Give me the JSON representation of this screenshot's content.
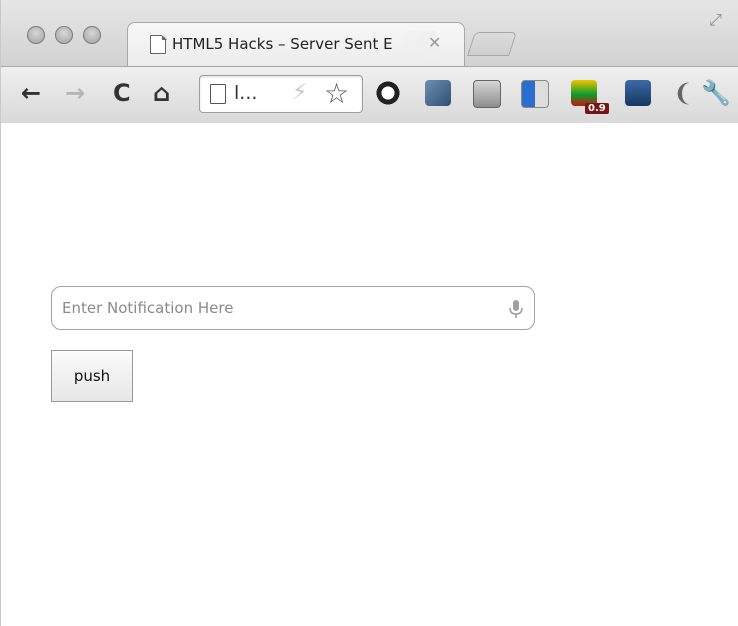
{
  "browser": {
    "tab": {
      "title": "HTML5 Hacks – Server Sent E",
      "close_glyph": "✕"
    },
    "toolbar": {
      "back_glyph": "←",
      "forward_glyph": "→",
      "reload_glyph": "C",
      "home_glyph": "⌂",
      "address_text": "l...",
      "bolt_glyph": "⚡",
      "star_glyph": "☆",
      "extensions": [
        {
          "name": "google-icon"
        },
        {
          "name": "php-icon"
        },
        {
          "name": "tag-icon"
        },
        {
          "name": "delicious-icon"
        },
        {
          "name": "colorzilla-icon",
          "badge": "0.9"
        },
        {
          "name": "microphone-extension-icon"
        }
      ],
      "wrench_glyph": "🔧"
    }
  },
  "page": {
    "notification_input": {
      "placeholder": "Enter Notification Here",
      "value": ""
    },
    "push_button_label": "push"
  },
  "colors": {
    "chrome_light": "#efefef",
    "chrome_dark": "#d2d2d2",
    "input_border": "#a3a3a3"
  }
}
